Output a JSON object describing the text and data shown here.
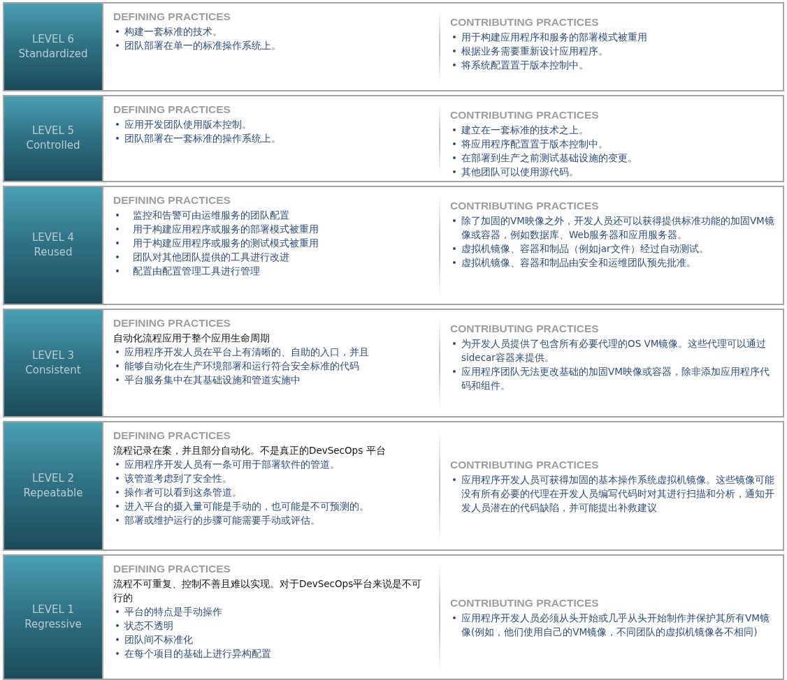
{
  "levels": [
    {
      "label": "LEVEL 6",
      "name": "Standardized",
      "defining": {
        "heading": "DEFINING PRACTICES",
        "items": [
          "构建一套标准的技术。",
          "团队部署在单一的标准操作系统上。"
        ]
      },
      "contributing": {
        "heading": "CONTRIBUTING PRACTICES",
        "items": [
          "用于构建应用程序和服务的部署模式被重用",
          "根据业务需要重新设计应用程序。",
          "将系统配置置于版本控制中。"
        ]
      }
    },
    {
      "label": "LEVEL 5",
      "name": "Controlled",
      "defining": {
        "heading": "DEFINING PRACTICES",
        "items": [
          "应用开发团队使用版本控制。",
          "团队部署在一套标准的操作系统上。"
        ]
      },
      "contributing": {
        "heading": "CONTRIBUTING PRACTICES",
        "items": [
          "建立在一套标准的技术之上。",
          "将应用程序配置置于版本控制中。",
          "在部署到生产之前测试基础设施的变更。",
          "其他团队可以使用源代码。"
        ]
      }
    },
    {
      "label": "LEVEL 4",
      "name": "Reused",
      "defining": {
        "heading": "DEFINING PRACTICES",
        "items": [
          "监控和告警可由运维服务的团队配置",
          "用于构建应用程序或服务的部署模式被重用",
          "用于构建应用程序或服务的测试模式被重用",
          "团队对其他团队提供的工具进行改进",
          "配置由配置管理工具进行管理"
        ]
      },
      "contributing": {
        "heading": "CONTRIBUTING PRACTICES",
        "items": [
          "除了加固的VM映像之外，开发人员还可以获得提供标准功能的加固VM镜像或容器，例如数据库、Web服务器和应用服务器。",
          "虚拟机镜像、容器和制品（例如jar文件）经过自动测试。",
          "虚拟机镜像、容器和制品由安全和运维团队预先批准。"
        ]
      }
    },
    {
      "label": "LEVEL 3",
      "name": "Consistent",
      "defining": {
        "heading": "DEFINING PRACTICES",
        "intro": "自动化流程应用于整个应用生命周期",
        "items": [
          "应用程序开发人员在平台上有清晰的、自助的入口，并且",
          "能够自动化在生产环境部署和运行符合安全标准的代码",
          "平台服务集中在其基础设施和管道实施中"
        ]
      },
      "contributing": {
        "heading": "CONTRIBUTING PRACTICES",
        "items": [
          "为开发人员提供了包含所有必要代理的OS VM镜像。这些代理可以通过sidecar容器来提供。",
          "应用程序团队无法更改基础的加固VM映像或容器，除非添加应用程序代码和组件。"
        ]
      }
    },
    {
      "label": "LEVEL 2",
      "name": "Repeatable",
      "defining": {
        "heading": "DEFINING PRACTICES",
        "intro": "流程记录在案，并且部分自动化。不是真正的DevSecOps 平台",
        "items": [
          "应用程序开发人员有一条可用于部署软件的管道。",
          "该管道考虑到了安全性。",
          "操作者可以看到这条管道。",
          "进入平台的摄入量可能是手动的，也可能是不可预测的。",
          "部署或维护运行的步骤可能需要手动或评估。"
        ]
      },
      "contributing": {
        "heading": "CONTRIBUTING PRACTICES",
        "items": [
          "应用程序开发人员可获得加固的基本操作系统虚拟机镜像。这些镜像可能没有所有必要的代理在开发人员编写代码时对其进行扫描和分析，通知开发人员潜在的代码缺陷，并可能提出补救建议"
        ]
      }
    },
    {
      "label": "LEVEL 1",
      "name": "Regressive",
      "defining": {
        "heading": "DEFINING PRACTICES",
        "intro": "流程不可重复、控制不善且难以实现。对于DevSecOps平台来说是不可行的",
        "items": [
          "平台的特点是手动操作",
          "状态不透明",
          "团队间不标准化",
          "在每个项目的基础上进行异构配置"
        ]
      },
      "contributing": {
        "heading": "CONTRIBUTING PRACTICES",
        "items": [
          "应用程序开发人员必须从头开始或几乎从头开始制作并保护其所有VM镜像(例如，他们使用自己的VM镜像，不同团队的虚拟机镜像各不相同)"
        ]
      }
    }
  ]
}
